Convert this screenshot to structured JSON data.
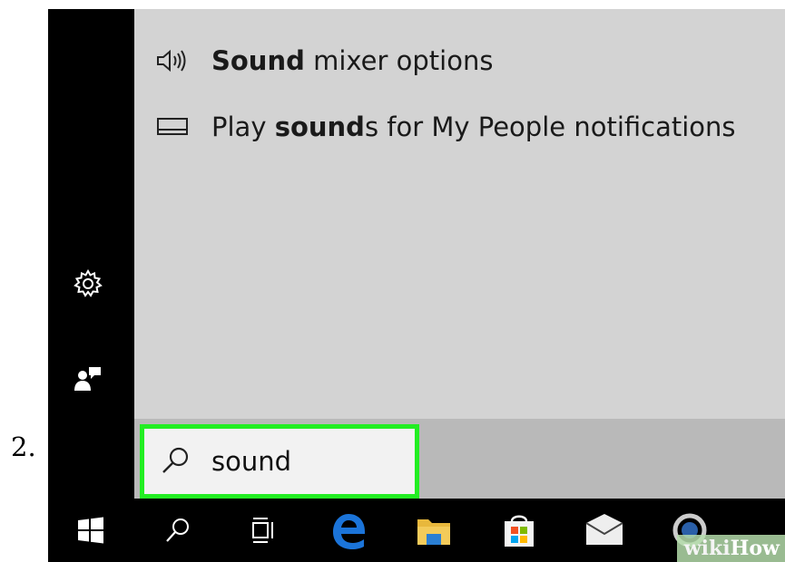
{
  "step": {
    "number": "2."
  },
  "results": [
    {
      "icon": "speaker-icon",
      "bold": "Sound",
      "rest": " mixer options"
    },
    {
      "icon": "display-icon",
      "pre": "Play ",
      "bold": "sound",
      "rest": "s for My People notifications"
    }
  ],
  "search": {
    "icon": "search-icon",
    "value": "sound"
  },
  "sidebar": {
    "items": [
      "gear-icon",
      "feedback-icon"
    ]
  },
  "taskbar": {
    "items": [
      "windows-start-icon",
      "search-icon",
      "task-view-icon",
      "edge-browser-icon",
      "file-explorer-icon",
      "store-icon",
      "mail-icon",
      "cortana-icon"
    ]
  },
  "watermark": {
    "part1": "wiki",
    "part2": "How"
  },
  "colors": {
    "search_highlight": "#22ee22",
    "edge_blue": "#1b74d9",
    "results_bg": "#d3d3d3",
    "taskbar_bg": "#000000"
  }
}
